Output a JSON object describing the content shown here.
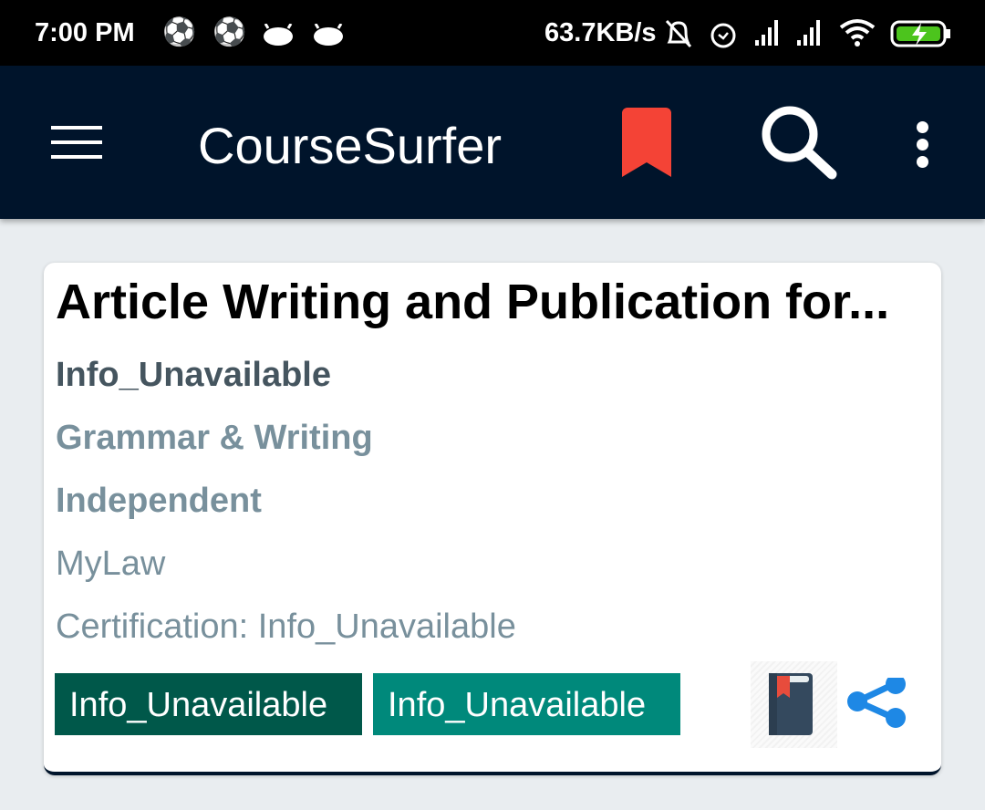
{
  "status": {
    "time": "7:00 PM",
    "speed": "63.7KB/s"
  },
  "appbar": {
    "title": "CourseSurfer"
  },
  "card": {
    "title": "Article Writing and Publication for...",
    "author": "Info_Unavailable",
    "category": "Grammar & Writing",
    "type": "Independent",
    "provider": "MyLaw",
    "certification": "Certification: Info_Unavailable",
    "tags": [
      "Info_Unavailable",
      "Info_Unavailable"
    ]
  },
  "colors": {
    "appbar": "#00142b",
    "accent": "#f44336",
    "tag1": "#00584a",
    "tag2": "#00897b",
    "share": "#1e88e5"
  }
}
